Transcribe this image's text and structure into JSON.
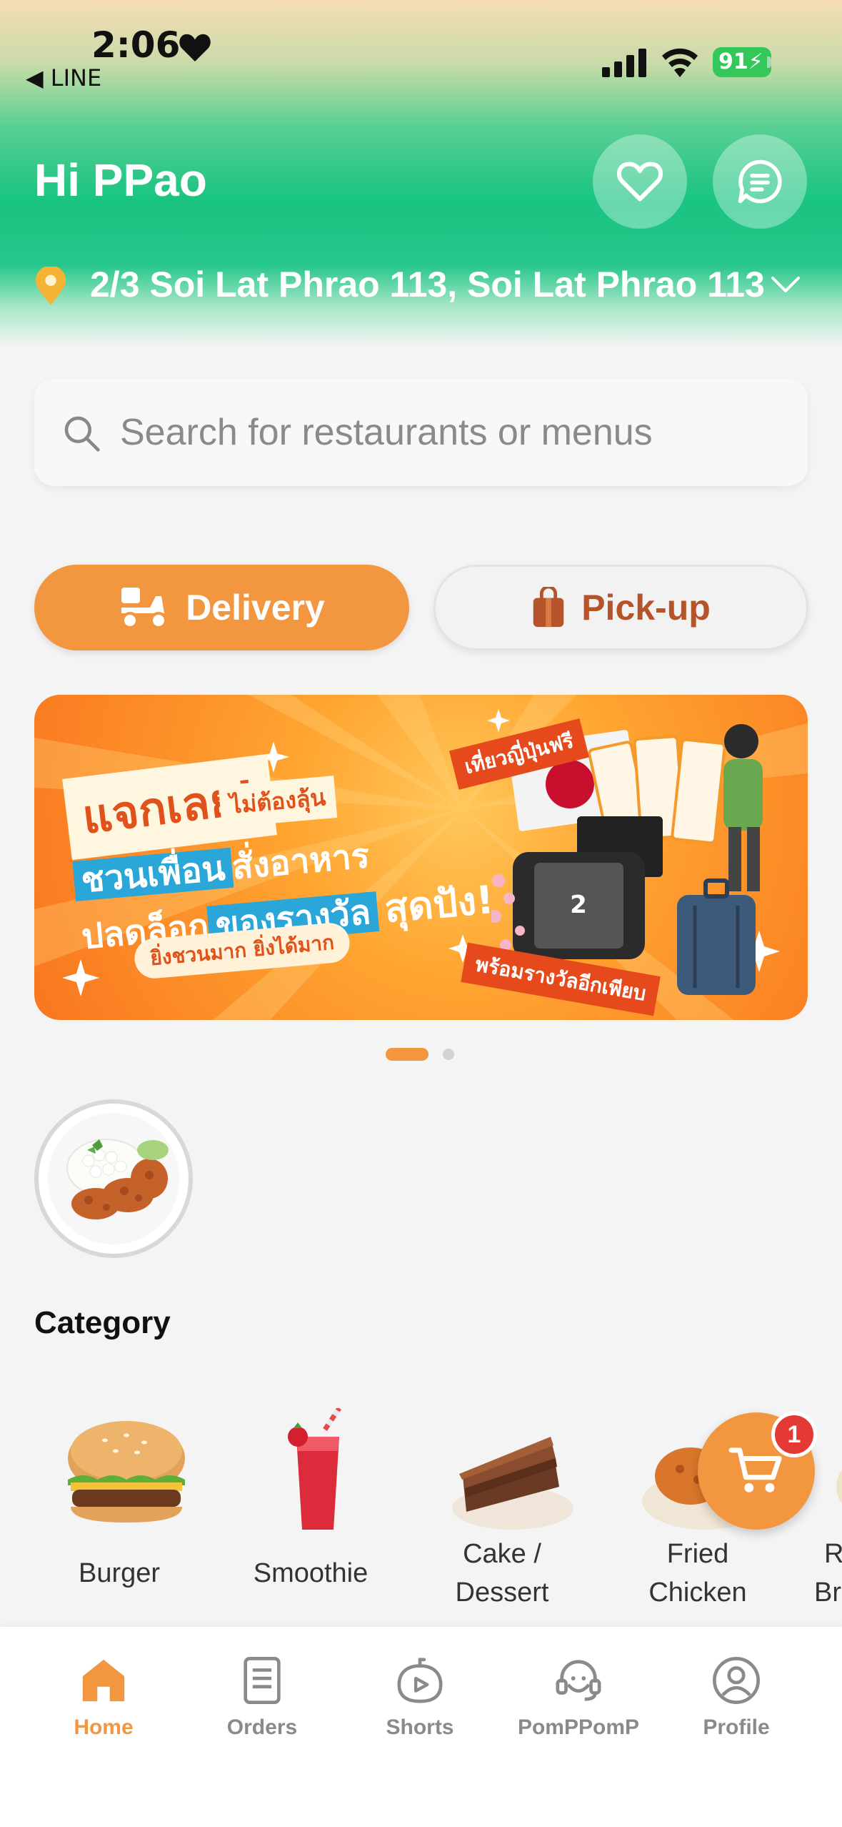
{
  "status_bar": {
    "time": "2:06",
    "back_label": "◀ LINE",
    "battery": "91"
  },
  "header": {
    "greeting": "Hi PPao",
    "address": "2/3 Soi Lat Phrao 113, Soi Lat Phrao 113",
    "icons": [
      "heart-icon",
      "chat-icon",
      "location-pin-icon",
      "chevron-down-icon"
    ]
  },
  "search": {
    "placeholder": "Search for restaurants or menus"
  },
  "mode": {
    "delivery_label": "Delivery",
    "pickup_label": "Pick-up",
    "selected": "Delivery"
  },
  "banner": {
    "title": "แจกเลย!",
    "subtitle": "ไม่ต้องลุ้น",
    "line1_highlight": "ชวนเพื่อน",
    "line1_rest": "สั่งอาหาร",
    "line2_start": "ปลดล็อก",
    "line2_highlight": "ของรางวัล",
    "line2_emphasis": "สุดปัง!",
    "pill": "ยิ่งชวนมาก ยิ่งได้มาก",
    "tag_top": "เที่ยวญี่ปุ่นฟรี",
    "tag_bottom": "พร้อมรางวัลอีกเพียบ",
    "page_count": 2,
    "active_page": 1
  },
  "category": {
    "title": "Category",
    "items": [
      {
        "label_line1": "Burger",
        "label_line2": ""
      },
      {
        "label_line1": "Smoothie",
        "label_line2": ""
      },
      {
        "label_line1": "Cake /",
        "label_line2": "Dessert"
      },
      {
        "label_line1": "Fried",
        "label_line2": "Chicken"
      },
      {
        "label_line1": "R",
        "label_line2": "Br"
      }
    ]
  },
  "cart": {
    "badge_count": "1"
  },
  "bottom_nav": {
    "items": [
      {
        "label": "Home",
        "active": true
      },
      {
        "label": "Orders",
        "active": false
      },
      {
        "label": "Shorts",
        "active": false
      },
      {
        "label": "PomPPomP",
        "active": false
      },
      {
        "label": "Profile",
        "active": false
      }
    ]
  },
  "colors": {
    "accent": "#f2963f",
    "header_green": "#19c482",
    "pickup_text": "#b5532a",
    "badge_red": "#e53935"
  }
}
